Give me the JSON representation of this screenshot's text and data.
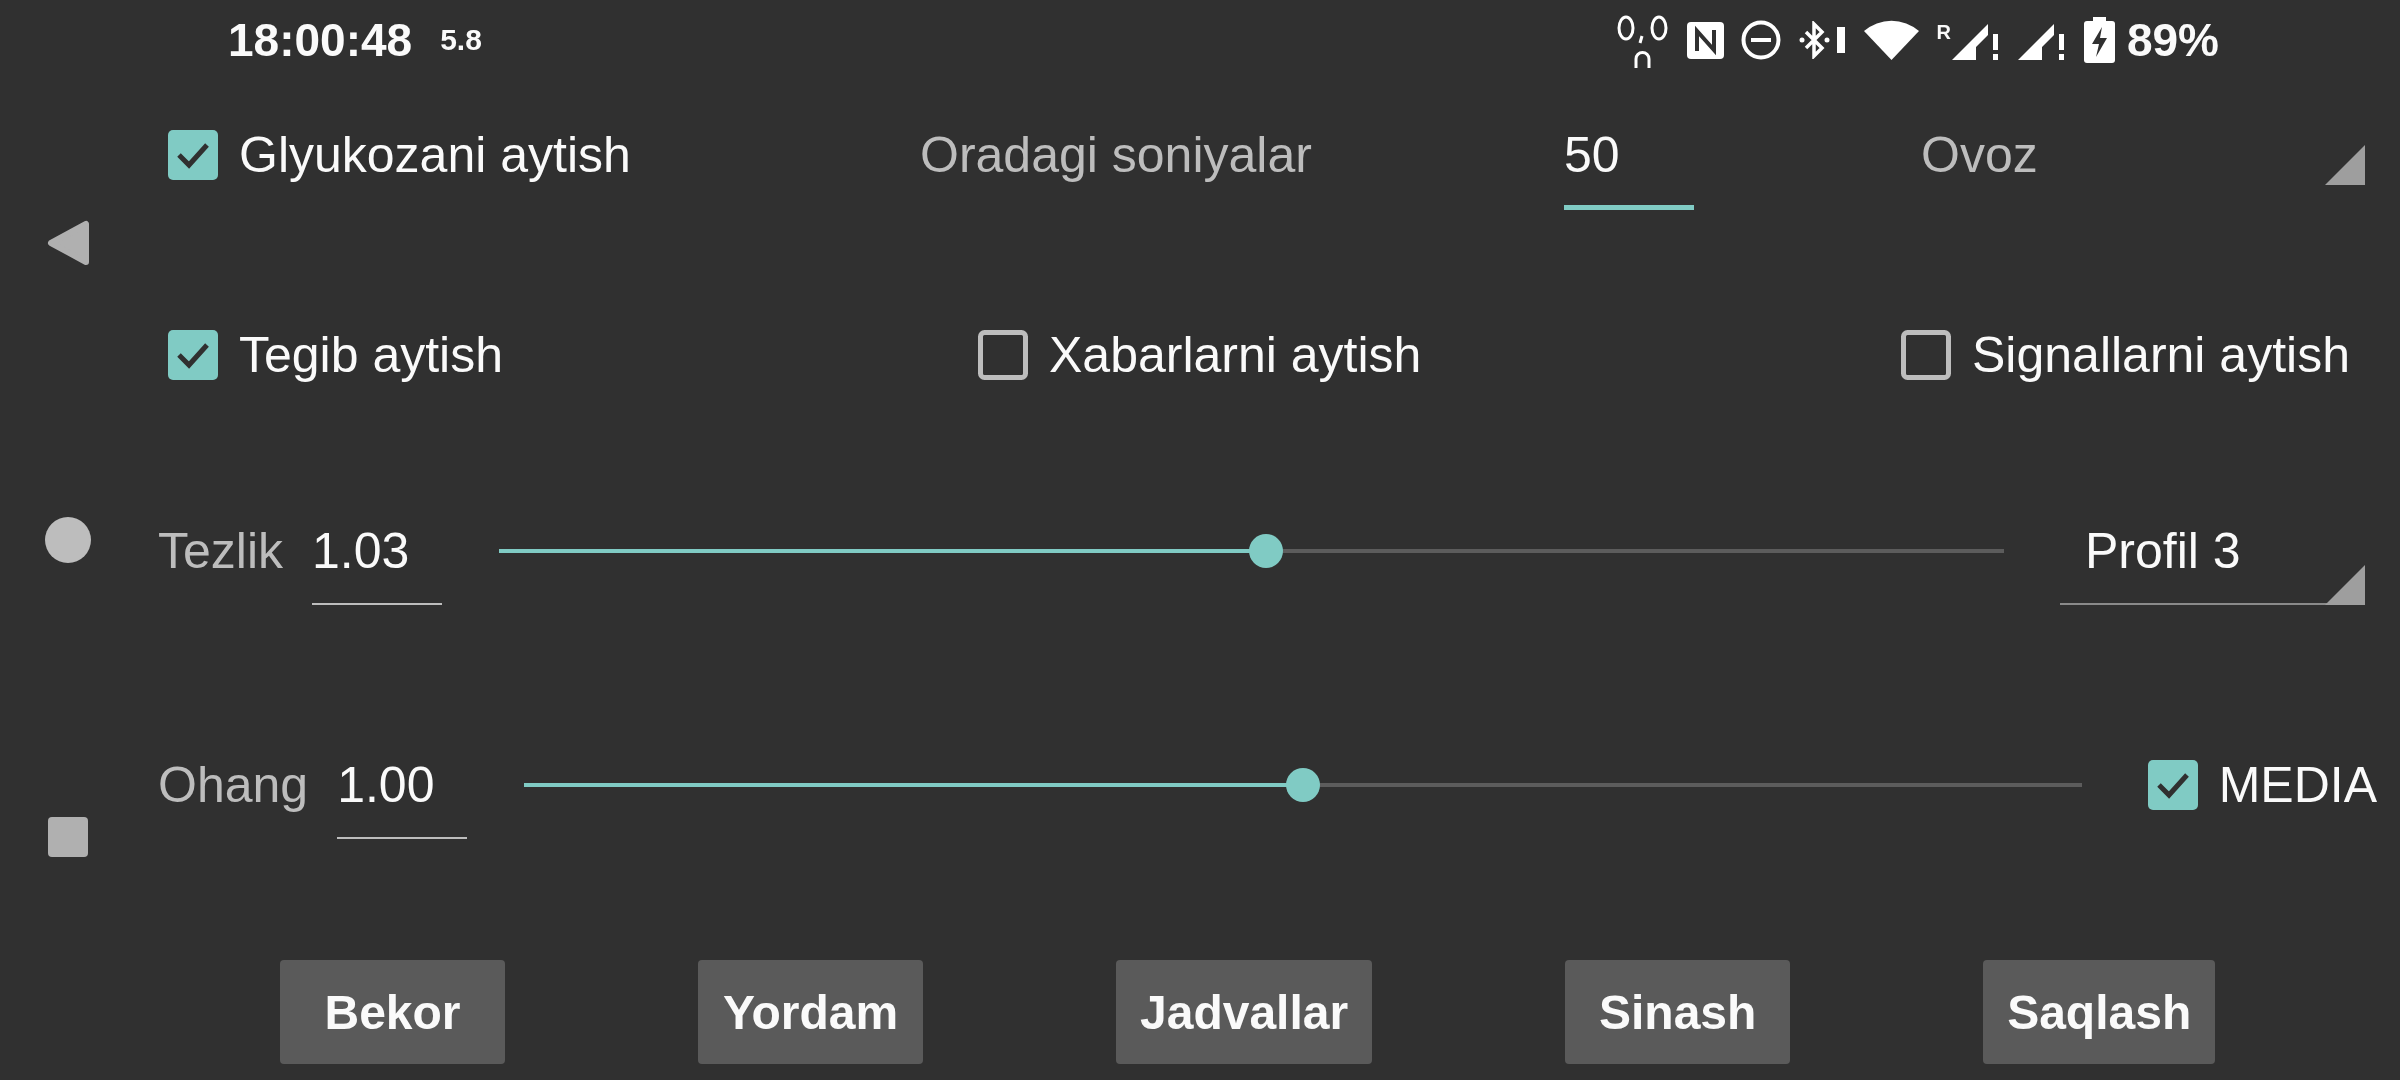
{
  "status_bar": {
    "time": "18:00:48",
    "speed": "5.8",
    "roaming": "R",
    "battery": "89%"
  },
  "speak_glucose": {
    "label": "Glyukozani aytish",
    "checked": true
  },
  "interval": {
    "label": "Oradagi soniyalar",
    "value": "50",
    "focused": true
  },
  "voice_spinner": {
    "placeholder": "Ovoz"
  },
  "options": [
    {
      "label": "Tegib aytish",
      "checked": true
    },
    {
      "label": "Xabarlarni aytish",
      "checked": false
    },
    {
      "label": "Signallarni aytish",
      "checked": false
    }
  ],
  "sliders": [
    {
      "label": "Tezlik",
      "value": "1.03",
      "focused": false,
      "level": 0.51
    },
    {
      "label": "Ohang",
      "value": "1.00",
      "focused": false,
      "level": 0.5
    }
  ],
  "profile_spinner": {
    "value": "Profil 3"
  },
  "media": {
    "label": "MEDIA",
    "checked": true
  },
  "buttons": [
    "Bekor",
    "Yordam",
    "Jadvallar",
    "Sinash",
    "Saqlash"
  ]
}
